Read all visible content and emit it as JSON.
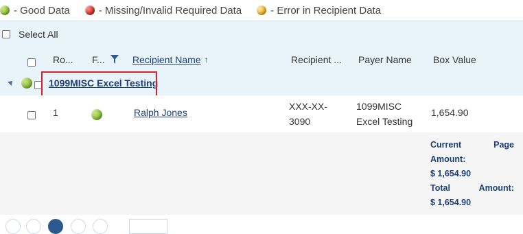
{
  "legend": {
    "items": [
      {
        "color": "green",
        "label": "- Good Data"
      },
      {
        "color": "red",
        "label": "- Missing/Invalid Required Data"
      },
      {
        "color": "yellow",
        "label": "- Error in Recipient Data"
      }
    ]
  },
  "select_all_label": "Select All",
  "columns": {
    "row": "Ro...",
    "flag": "F...",
    "recipient_name": "Recipient Name",
    "recipient_tin": "Recipient ...",
    "payer_name": "Payer Name",
    "box_value": "Box Value"
  },
  "sort_indicator": "↑",
  "group": {
    "title": "1099MISC Excel Testing",
    "status_color": "green"
  },
  "row": {
    "row_no": "1",
    "status_color": "green",
    "recipient_name": "Ralph Jones",
    "tin_line1": "XXX-XX-",
    "tin_line2": "3090",
    "payer_line1": "1099MISC",
    "payer_line2": "Excel Testing",
    "box_value": "1,654.90"
  },
  "summary": {
    "current_page_word1": "Current",
    "current_page_word2": "Page",
    "amount_label": "Amount:",
    "current_amount": "$ 1,654.90",
    "total_word": "Total",
    "total_amount_label": "Amount:",
    "total_amount": "$ 1,654.90"
  }
}
